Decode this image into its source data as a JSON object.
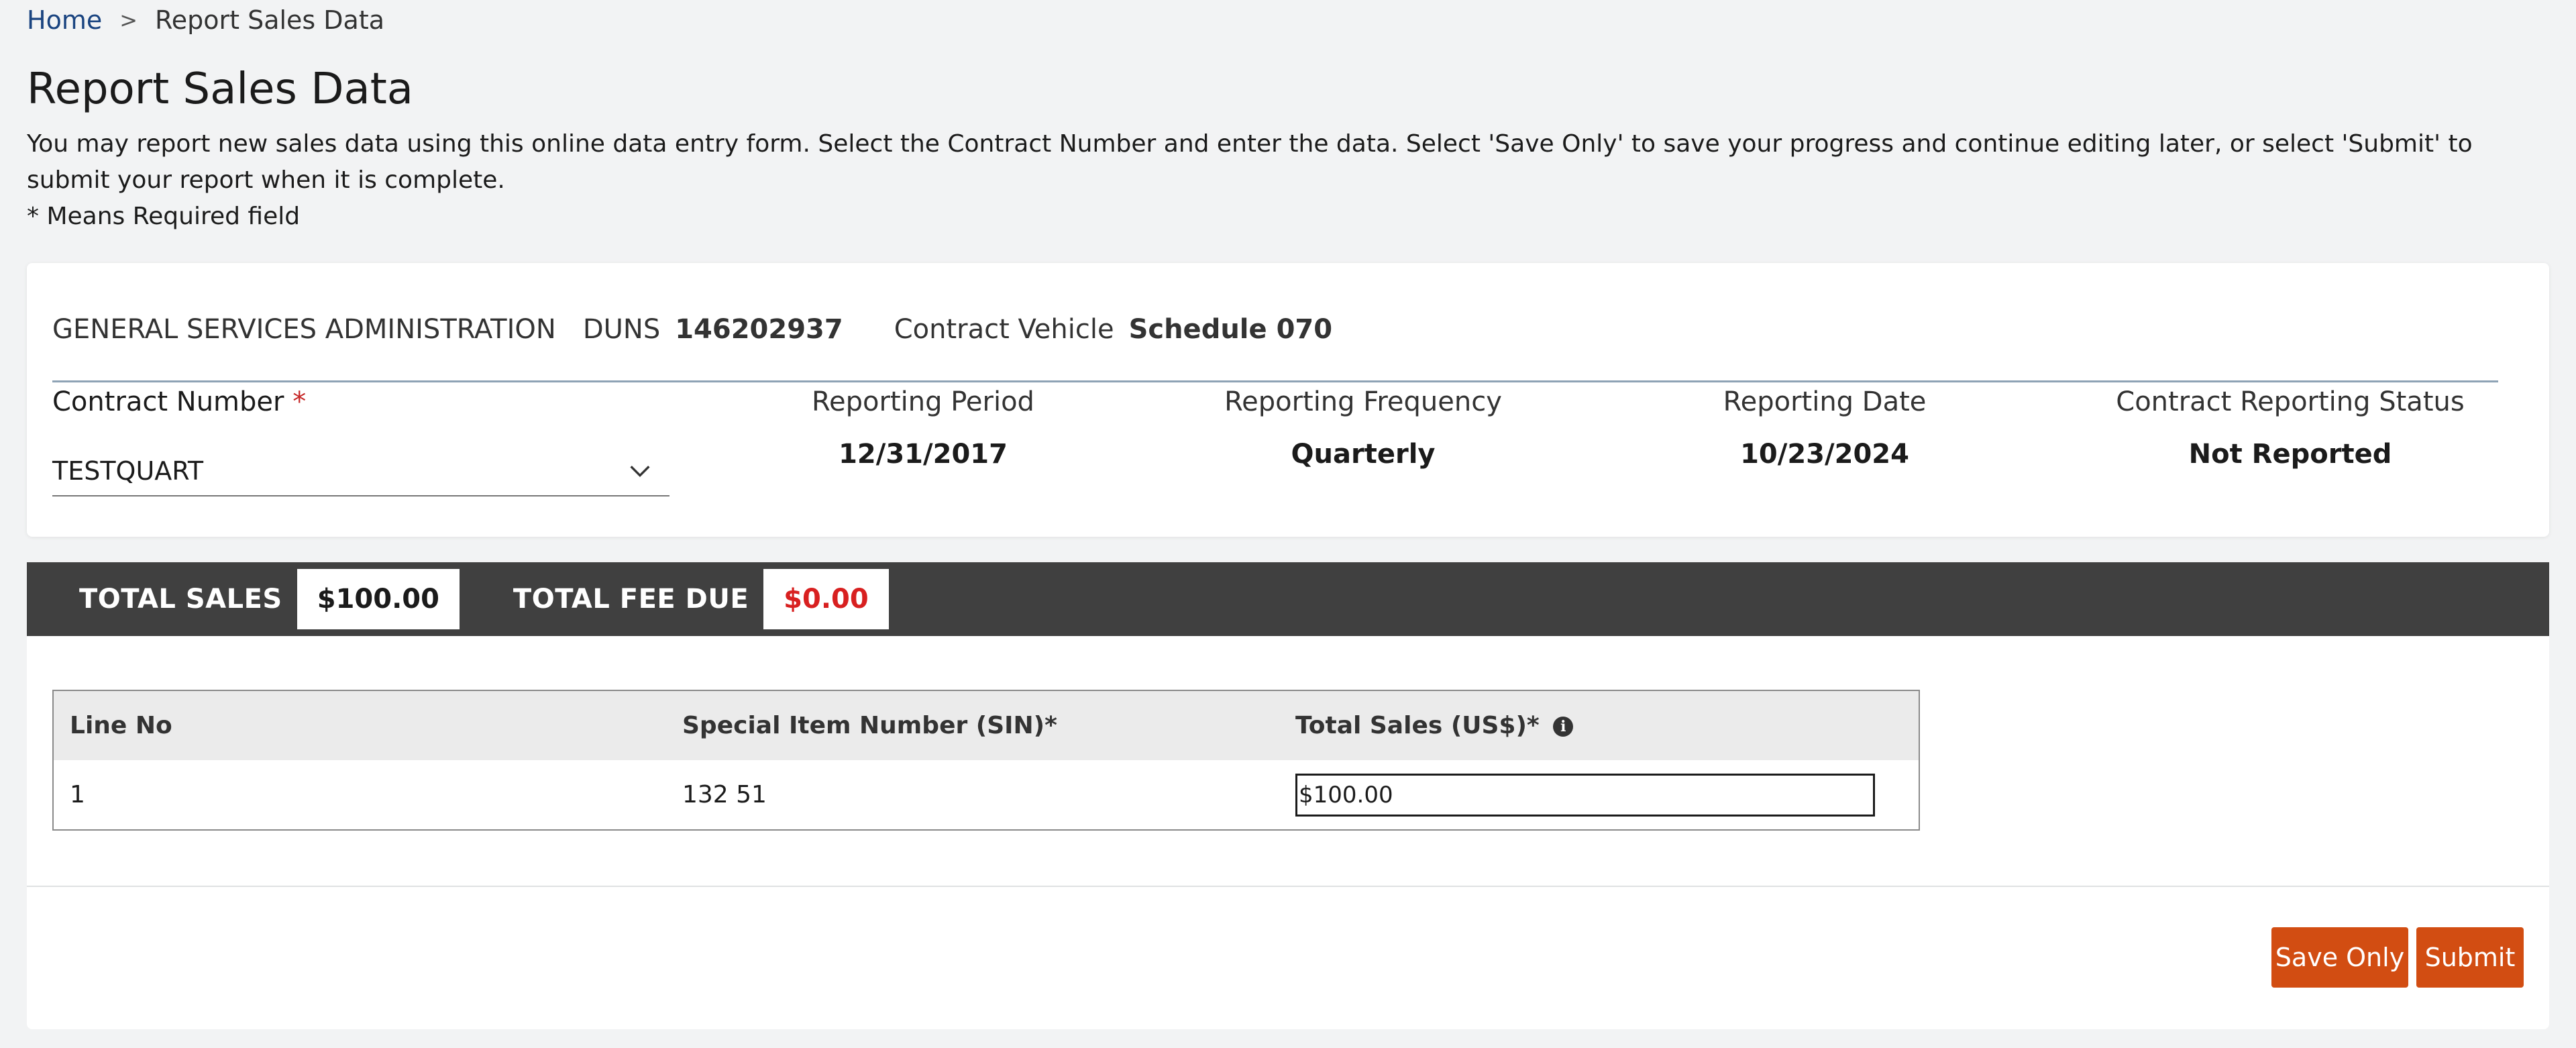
{
  "breadcrumb": {
    "home": "Home",
    "separator": ">",
    "current": "Report Sales Data"
  },
  "page": {
    "title": "Report Sales Data",
    "intro": "You may report new sales data using this online data entry form. Select the Contract Number and enter the data. Select 'Save Only' to save your progress and continue editing later, or select 'Submit' to submit your report when it is complete.",
    "required_note": "* Means Required field"
  },
  "vendor": {
    "name": "GENERAL SERVICES ADMINISTRATION",
    "duns_label": "DUNS",
    "duns": "146202937",
    "vehicle_label": "Contract Vehicle",
    "vehicle": "Schedule 070"
  },
  "contract": {
    "label": "Contract Number",
    "required_mark": "*",
    "selected": "TESTQUART"
  },
  "info": [
    {
      "label": "Reporting Period",
      "value": "12/31/2017"
    },
    {
      "label": "Reporting Frequency",
      "value": "Quarterly"
    },
    {
      "label": "Reporting Date",
      "value": "10/23/2024"
    },
    {
      "label": "Contract Reporting Status",
      "value": "Not Reported"
    }
  ],
  "totals": {
    "sales_label": "TOTAL SALES",
    "sales_value": "$100.00",
    "fee_label": "TOTAL FEE DUE",
    "fee_value": "$0.00",
    "fee_color": "#d82020"
  },
  "table": {
    "headers": [
      "Line No",
      "Special Item Number (SIN)*",
      "Total Sales (US$)*"
    ],
    "info_icon": "info-icon",
    "rows": [
      {
        "line": "1",
        "sin": "132 51",
        "sales": "$100.00"
      }
    ]
  },
  "actions": {
    "save": "Save Only",
    "submit": "Submit",
    "accent": "#d24d12"
  }
}
